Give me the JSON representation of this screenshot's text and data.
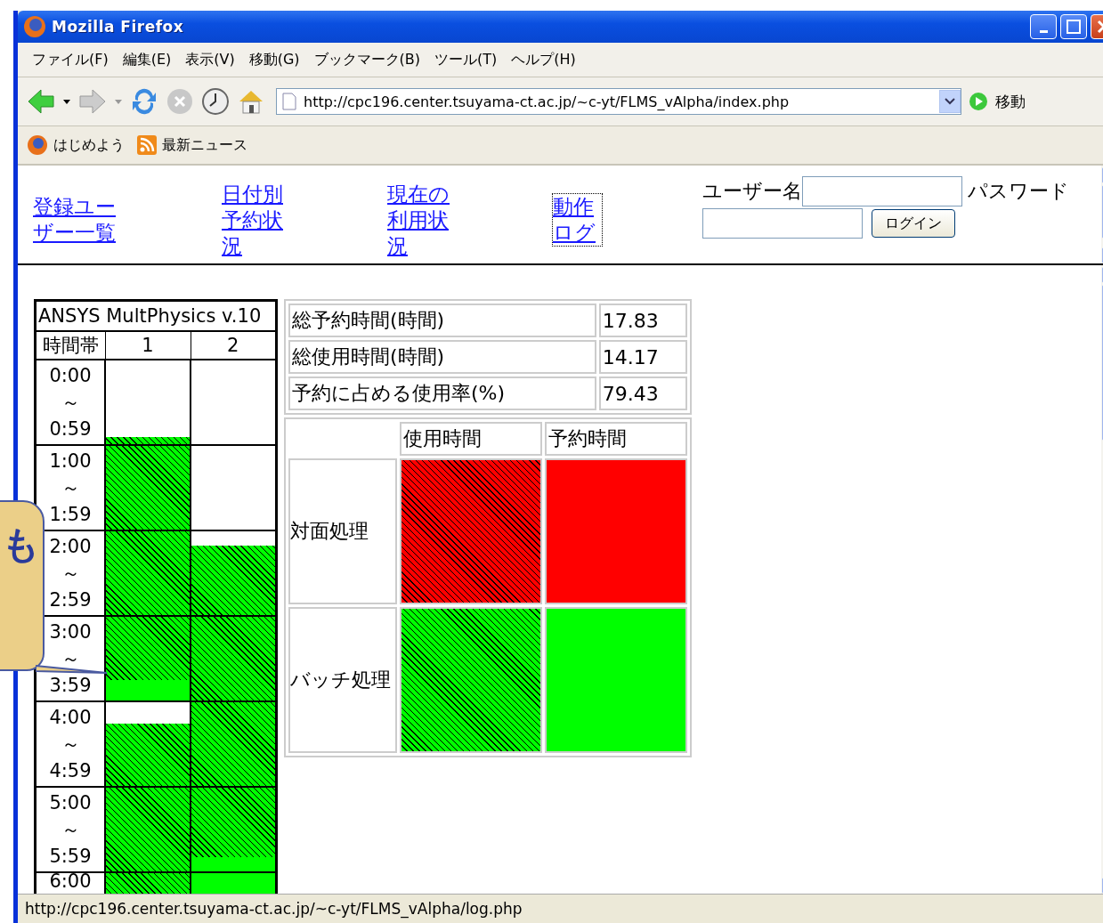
{
  "window": {
    "title": "Mozilla Firefox"
  },
  "menu": [
    "ファイル(F)",
    "編集(E)",
    "表示(V)",
    "移動(G)",
    "ブックマーク(B)",
    "ツール(T)",
    "ヘルプ(H)"
  ],
  "toolbar": {
    "url": "http://cpc196.center.tsuyama-ct.ac.jp/~c-yt/FLMS_vAlpha/index.php",
    "go_label": "移動"
  },
  "bookmarks": [
    "はじめよう",
    "最新ニュース"
  ],
  "nav_links": [
    {
      "label": "登録ユーザー一覧",
      "focused": false
    },
    {
      "label": "日付別予約状況",
      "focused": false
    },
    {
      "label": "現在の利用状況",
      "focused": false
    },
    {
      "label": "動作ログ",
      "focused": true
    }
  ],
  "login": {
    "username_label": "ユーザー名",
    "password_label": "パスワード",
    "button": "ログイン"
  },
  "schedule": {
    "title": "ANSYS MultPhysics v.10",
    "header": "時間帯",
    "columns": [
      "1",
      "2"
    ],
    "rows": [
      {
        "start": "0:00",
        "sep": "～",
        "end": "0:59",
        "cells": [
          [
            {
              "kind": "empty"
            },
            {
              "kind": "empty"
            },
            {
              "kind": "empty"
            },
            {
              "kind": "empty"
            },
            {
              "kind": "empty"
            },
            {
              "kind": "empty"
            },
            {
              "kind": "empty"
            },
            {
              "kind": "empty"
            },
            {
              "kind": "empty"
            },
            {
              "kind": "empty"
            },
            {
              "kind": "empty"
            },
            {
              "kind": "used"
            }
          ],
          [
            {
              "kind": "empty"
            },
            {
              "kind": "empty"
            },
            {
              "kind": "empty"
            },
            {
              "kind": "empty"
            },
            {
              "kind": "empty"
            },
            {
              "kind": "empty"
            },
            {
              "kind": "empty"
            },
            {
              "kind": "empty"
            },
            {
              "kind": "empty"
            },
            {
              "kind": "empty"
            },
            {
              "kind": "empty"
            },
            {
              "kind": "empty"
            }
          ]
        ]
      },
      {
        "start": "1:00",
        "sep": "～",
        "end": "1:59",
        "cells": [
          [
            {
              "kind": "used"
            },
            {
              "kind": "used"
            },
            {
              "kind": "used"
            },
            {
              "kind": "used"
            },
            {
              "kind": "used"
            },
            {
              "kind": "used"
            },
            {
              "kind": "used"
            },
            {
              "kind": "used"
            },
            {
              "kind": "used"
            },
            {
              "kind": "used"
            },
            {
              "kind": "used"
            },
            {
              "kind": "used"
            }
          ],
          [
            {
              "kind": "empty"
            },
            {
              "kind": "empty"
            },
            {
              "kind": "empty"
            },
            {
              "kind": "empty"
            },
            {
              "kind": "empty"
            },
            {
              "kind": "empty"
            },
            {
              "kind": "empty"
            },
            {
              "kind": "empty"
            },
            {
              "kind": "empty"
            },
            {
              "kind": "empty"
            },
            {
              "kind": "empty"
            },
            {
              "kind": "empty"
            }
          ]
        ]
      },
      {
        "start": "2:00",
        "sep": "～",
        "end": "2:59",
        "cells": [
          [
            {
              "kind": "used"
            },
            {
              "kind": "used"
            },
            {
              "kind": "used"
            },
            {
              "kind": "used"
            },
            {
              "kind": "used"
            },
            {
              "kind": "used"
            },
            {
              "kind": "used"
            },
            {
              "kind": "used"
            },
            {
              "kind": "used"
            },
            {
              "kind": "used"
            },
            {
              "kind": "used"
            },
            {
              "kind": "used"
            }
          ],
          [
            {
              "kind": "empty"
            },
            {
              "kind": "empty"
            },
            {
              "kind": "used"
            },
            {
              "kind": "used"
            },
            {
              "kind": "used"
            },
            {
              "kind": "used"
            },
            {
              "kind": "used"
            },
            {
              "kind": "used"
            },
            {
              "kind": "used"
            },
            {
              "kind": "used"
            },
            {
              "kind": "used"
            },
            {
              "kind": "used"
            }
          ]
        ]
      },
      {
        "start": "3:00",
        "sep": "～",
        "end": "3:59",
        "cells": [
          [
            {
              "kind": "used"
            },
            {
              "kind": "used"
            },
            {
              "kind": "used"
            },
            {
              "kind": "used"
            },
            {
              "kind": "used"
            },
            {
              "kind": "used"
            },
            {
              "kind": "used"
            },
            {
              "kind": "used"
            },
            {
              "kind": "used"
            },
            {
              "kind": "reserved"
            },
            {
              "kind": "reserved"
            },
            {
              "kind": "reserved"
            }
          ],
          [
            {
              "kind": "used"
            },
            {
              "kind": "used"
            },
            {
              "kind": "used"
            },
            {
              "kind": "used"
            },
            {
              "kind": "used"
            },
            {
              "kind": "used"
            },
            {
              "kind": "used"
            },
            {
              "kind": "used"
            },
            {
              "kind": "used"
            },
            {
              "kind": "used"
            },
            {
              "kind": "used"
            },
            {
              "kind": "used"
            }
          ]
        ]
      },
      {
        "start": "4:00",
        "sep": "～",
        "end": "4:59",
        "cells": [
          [
            {
              "kind": "empty"
            },
            {
              "kind": "empty"
            },
            {
              "kind": "empty"
            },
            {
              "kind": "used"
            },
            {
              "kind": "used"
            },
            {
              "kind": "used"
            },
            {
              "kind": "used"
            },
            {
              "kind": "used"
            },
            {
              "kind": "used"
            },
            {
              "kind": "used"
            },
            {
              "kind": "used"
            },
            {
              "kind": "used"
            }
          ],
          [
            {
              "kind": "used"
            },
            {
              "kind": "used"
            },
            {
              "kind": "used"
            },
            {
              "kind": "used"
            },
            {
              "kind": "used"
            },
            {
              "kind": "used"
            },
            {
              "kind": "used"
            },
            {
              "kind": "used"
            },
            {
              "kind": "used"
            },
            {
              "kind": "used"
            },
            {
              "kind": "used"
            },
            {
              "kind": "used"
            }
          ]
        ]
      },
      {
        "start": "5:00",
        "sep": "～",
        "end": "5:59",
        "cells": [
          [
            {
              "kind": "used"
            },
            {
              "kind": "used"
            },
            {
              "kind": "used"
            },
            {
              "kind": "used"
            },
            {
              "kind": "used"
            },
            {
              "kind": "used"
            },
            {
              "kind": "used"
            },
            {
              "kind": "used"
            },
            {
              "kind": "used"
            },
            {
              "kind": "used"
            },
            {
              "kind": "used"
            },
            {
              "kind": "used"
            }
          ],
          [
            {
              "kind": "used"
            },
            {
              "kind": "used"
            },
            {
              "kind": "used"
            },
            {
              "kind": "used"
            },
            {
              "kind": "used"
            },
            {
              "kind": "used"
            },
            {
              "kind": "used"
            },
            {
              "kind": "used"
            },
            {
              "kind": "used"
            },
            {
              "kind": "used"
            },
            {
              "kind": "reserved"
            },
            {
              "kind": "reserved"
            }
          ]
        ]
      },
      {
        "start": "6:00",
        "cells": [
          [
            {
              "kind": "used"
            },
            {
              "kind": "used"
            },
            {
              "kind": "used"
            },
            {
              "kind": "used"
            },
            {
              "kind": "used"
            },
            {
              "kind": "used"
            },
            {
              "kind": "used"
            },
            {
              "kind": "used"
            },
            {
              "kind": "used"
            },
            {
              "kind": "used"
            },
            {
              "kind": "used"
            },
            {
              "kind": "used"
            }
          ],
          [
            {
              "kind": "reserved"
            },
            {
              "kind": "reserved"
            },
            {
              "kind": "reserved"
            },
            {
              "kind": "reserved"
            },
            {
              "kind": "reserved"
            },
            {
              "kind": "reserved"
            },
            {
              "kind": "reserved"
            },
            {
              "kind": "reserved"
            },
            {
              "kind": "reserved"
            },
            {
              "kind": "reserved"
            },
            {
              "kind": "reserved"
            },
            {
              "kind": "reserved"
            }
          ]
        ]
      }
    ]
  },
  "stats": [
    {
      "label": "総予約時間(時間)",
      "value": "17.83"
    },
    {
      "label": "総使用時間(時間)",
      "value": "14.17"
    },
    {
      "label": "予約に占める使用率(%)",
      "value": "79.43"
    }
  ],
  "legend": {
    "columns": [
      "使用時間",
      "予約時間"
    ],
    "rows": [
      {
        "label": "対面処理",
        "color": "#ff0000"
      },
      {
        "label": "バッチ処理",
        "color": "#00ff00"
      }
    ]
  },
  "status_bar": "http://cpc196.center.tsuyama-ct.ac.jp/~c-yt/FLMS_vAlpha/log.php",
  "callout": {
    "text": "も"
  }
}
